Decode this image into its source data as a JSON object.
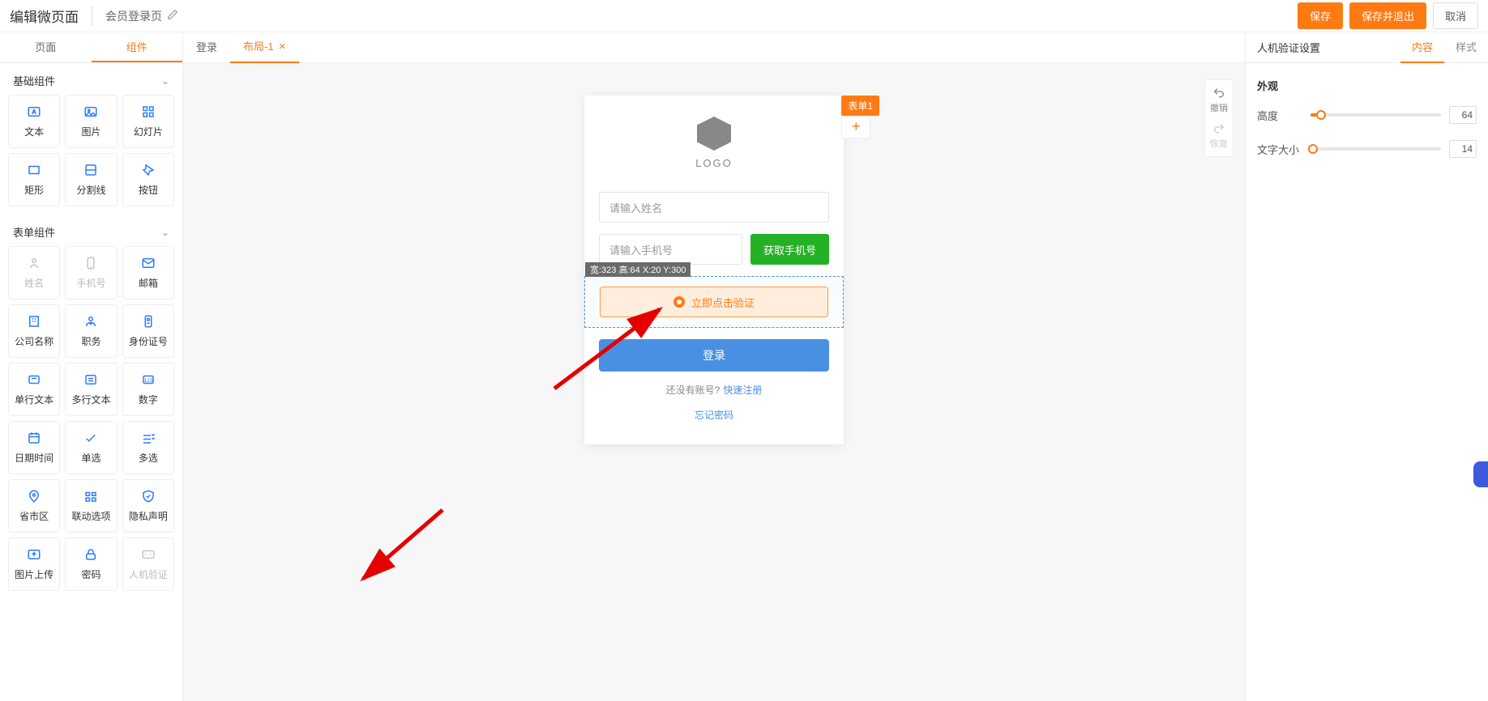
{
  "header": {
    "title": "编辑微页面",
    "subtitle": "会员登录页",
    "save": "保存",
    "save_exit": "保存并退出",
    "cancel": "取消"
  },
  "left": {
    "tabs": {
      "page": "页面",
      "component": "组件"
    },
    "group_basic": "基础组件",
    "group_form": "表单组件",
    "basic_items": [
      {
        "label": "文本",
        "icon": "text"
      },
      {
        "label": "图片",
        "icon": "image"
      },
      {
        "label": "幻灯片",
        "icon": "slide"
      },
      {
        "label": "矩形",
        "icon": "rect"
      },
      {
        "label": "分割线",
        "icon": "divider"
      },
      {
        "label": "按钮",
        "icon": "button"
      }
    ],
    "form_items": [
      {
        "label": "姓名",
        "icon": "user",
        "disabled": true
      },
      {
        "label": "手机号",
        "icon": "phone",
        "disabled": true
      },
      {
        "label": "邮箱",
        "icon": "mail",
        "disabled": false
      },
      {
        "label": "公司名称",
        "icon": "company",
        "disabled": false
      },
      {
        "label": "职务",
        "icon": "job",
        "disabled": false
      },
      {
        "label": "身份证号",
        "icon": "idcard",
        "disabled": false
      },
      {
        "label": "单行文本",
        "icon": "textline",
        "disabled": false
      },
      {
        "label": "多行文本",
        "icon": "textarea",
        "disabled": false
      },
      {
        "label": "数字",
        "icon": "number",
        "disabled": false
      },
      {
        "label": "日期时间",
        "icon": "date",
        "disabled": false
      },
      {
        "label": "单选",
        "icon": "radio",
        "disabled": false
      },
      {
        "label": "多选",
        "icon": "check",
        "disabled": false
      },
      {
        "label": "省市区",
        "icon": "location",
        "disabled": false
      },
      {
        "label": "联动选项",
        "icon": "linked",
        "disabled": false
      },
      {
        "label": "隐私声明",
        "icon": "privacy",
        "disabled": false
      },
      {
        "label": "图片上传",
        "icon": "upload",
        "disabled": false
      },
      {
        "label": "密码",
        "icon": "lock",
        "disabled": false
      },
      {
        "label": "人机验证",
        "icon": "captcha",
        "disabled": true
      }
    ]
  },
  "center": {
    "tab_login": "登录",
    "tab_layout": "布局-1",
    "form_tag": "表单1",
    "logo_text": "LOGO",
    "name_placeholder": "请输入姓名",
    "phone_placeholder": "请输入手机号",
    "get_phone": "获取手机号",
    "sel_info": "宽:323 高:64 X:20 Y:300",
    "captcha_label": "立即点击验证",
    "login_btn": "登录",
    "no_account": "还没有账号?",
    "quick_reg": "快速注册",
    "forgot": "忘记密码",
    "undo": "撤销",
    "redo": "恢复"
  },
  "right": {
    "panel_title": "人机验证设置",
    "tab_content": "内容",
    "tab_style": "样式",
    "section": "外观",
    "height_label": "高度",
    "height_val": "64",
    "font_label": "文字大小",
    "font_val": "14"
  }
}
